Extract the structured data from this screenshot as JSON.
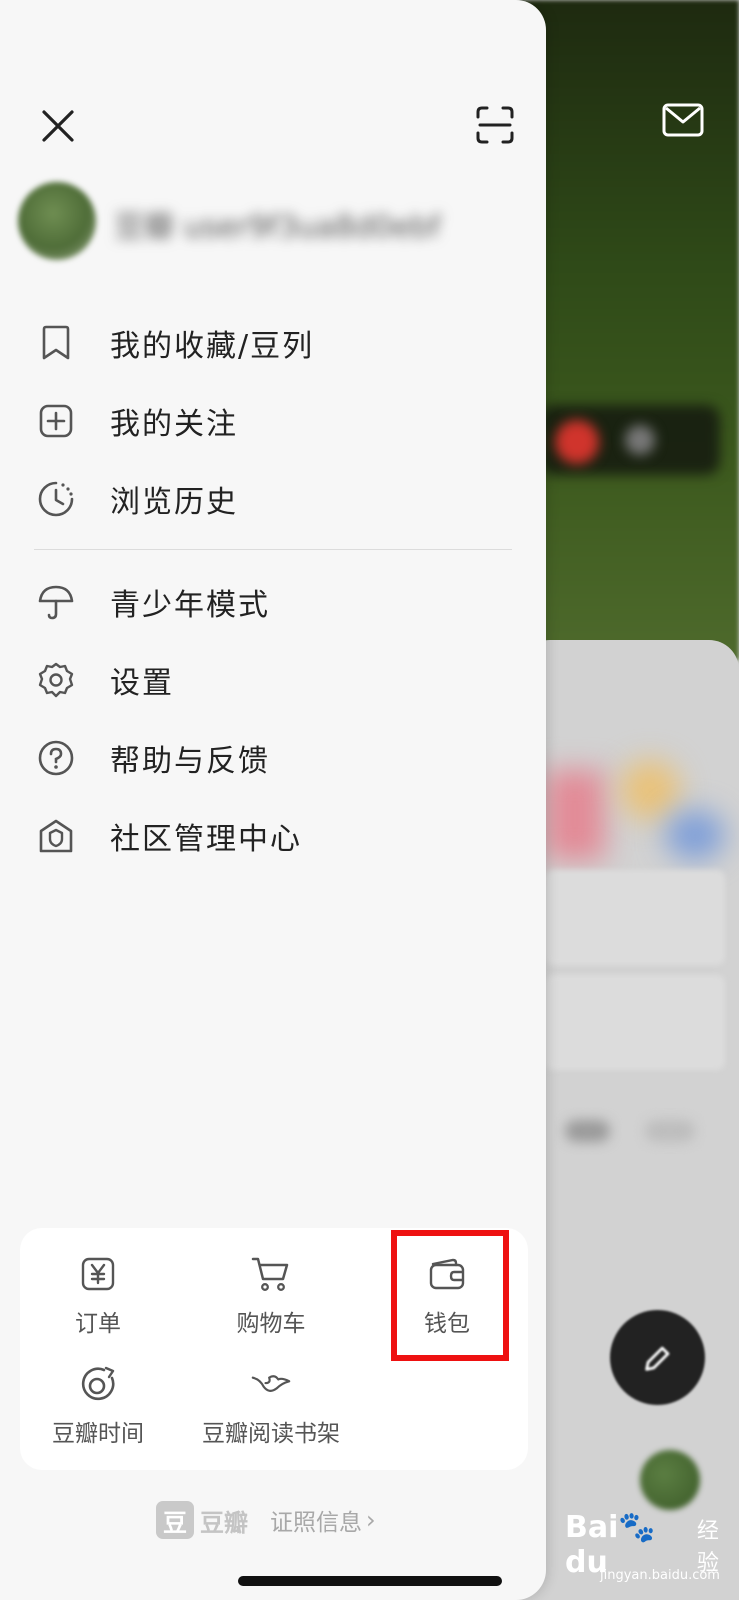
{
  "header": {
    "close_icon": "close-icon",
    "scan_icon": "scan-icon",
    "mail_icon": "mail-icon"
  },
  "profile": {
    "username": "豆瓣 user9f3ua8d0ebf"
  },
  "menu": {
    "group1": [
      {
        "label": "我的收藏/豆列",
        "icon": "bookmark-icon"
      },
      {
        "label": "我的关注",
        "icon": "plus-square-icon"
      },
      {
        "label": "浏览历史",
        "icon": "history-clock-icon"
      }
    ],
    "group2": [
      {
        "label": "青少年模式",
        "icon": "umbrella-icon"
      },
      {
        "label": "设置",
        "icon": "gear-icon"
      },
      {
        "label": "帮助与反馈",
        "icon": "help-icon"
      },
      {
        "label": "社区管理中心",
        "icon": "shield-house-icon"
      }
    ]
  },
  "tools": [
    {
      "label": "订单",
      "icon": "order-yen-icon"
    },
    {
      "label": "购物车",
      "icon": "cart-icon"
    },
    {
      "label": "钱包",
      "icon": "wallet-icon"
    },
    {
      "label": "豆瓣时间",
      "icon": "douban-time-icon"
    },
    {
      "label": "豆瓣阅读书架",
      "icon": "bird-icon"
    }
  ],
  "footer": {
    "brand_badge": "豆",
    "brand_name": "豆瓣",
    "license_label": "证照信息",
    "chevron": "›"
  },
  "watermark": {
    "logo": "Bai🐾du",
    "text": "经验",
    "url": "jingyan.baidu.com"
  },
  "colors": {
    "drawer_bg": "#f7f7f7",
    "highlight": "#ee1111",
    "text_primary": "#222222",
    "text_secondary": "#555555"
  }
}
